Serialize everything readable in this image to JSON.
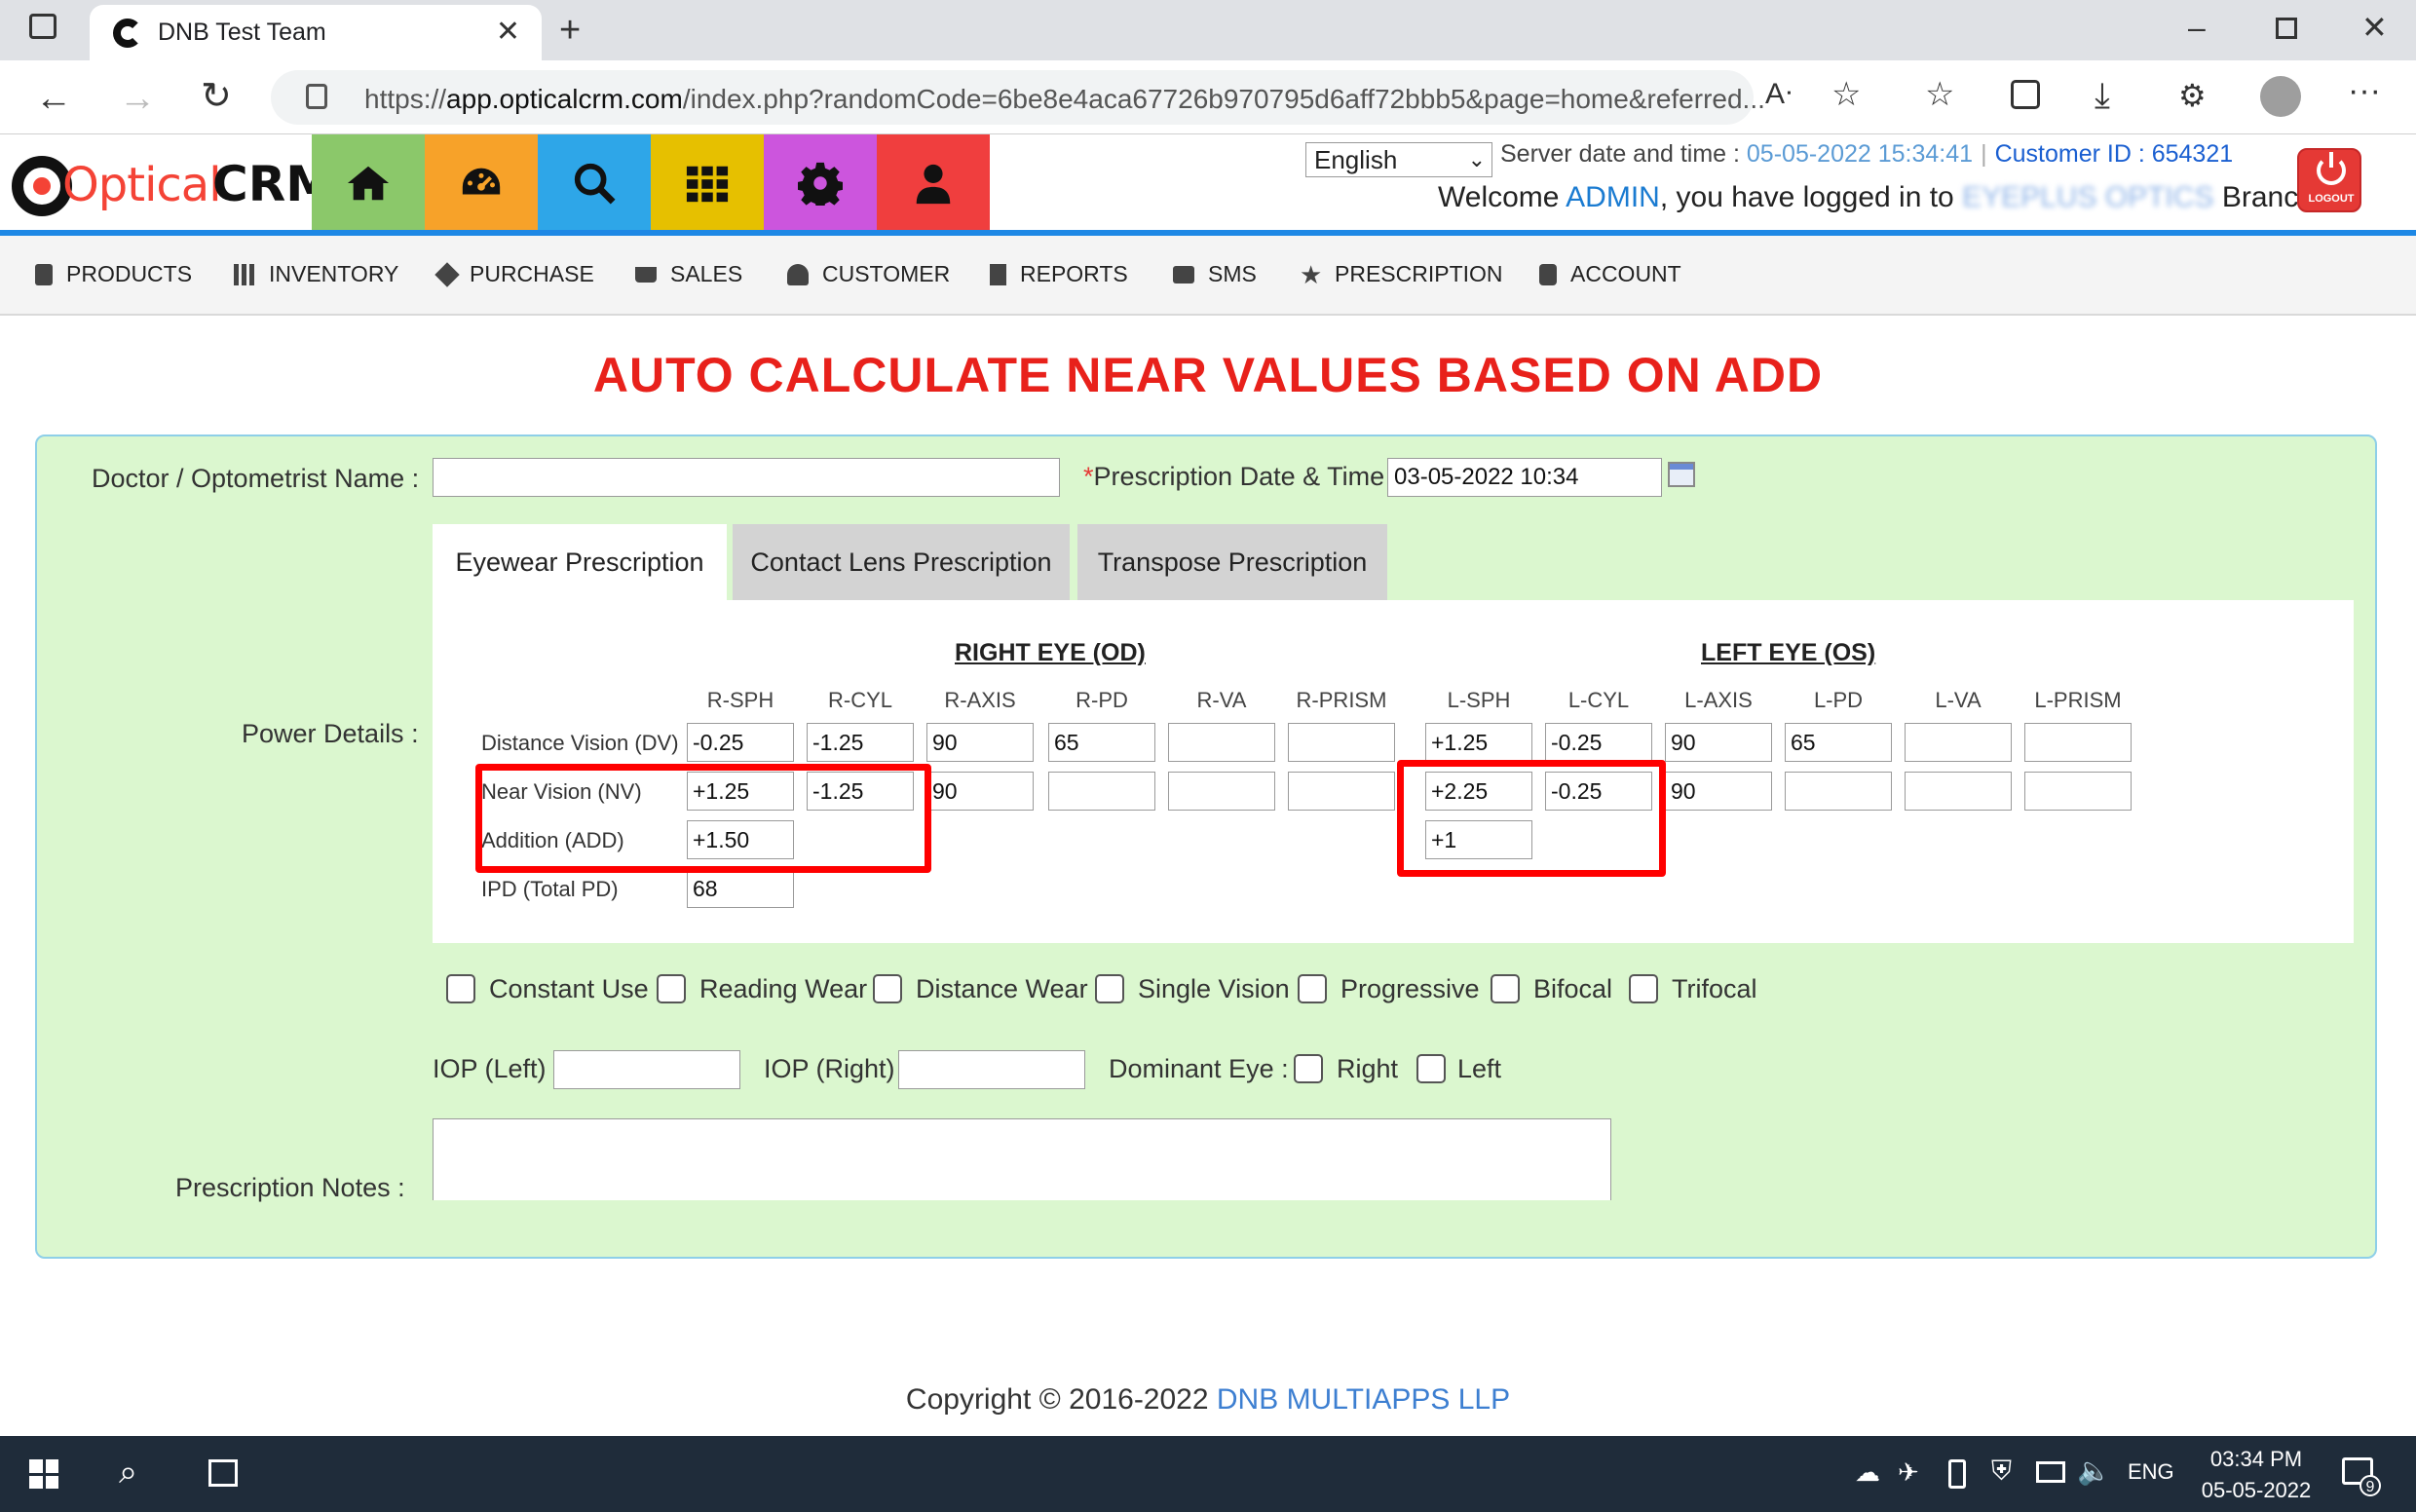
{
  "browser": {
    "tab_title": "DNB Test Team",
    "url_prefix": "https://",
    "url_host": "app.opticalcrm.com",
    "url_rest": "/index.php?randomCode=6be8e4aca67726b970795d6aff72bbb5&page=home&referred..."
  },
  "header": {
    "logo_part1": "Optical",
    "logo_part2": "CRM",
    "language": "English",
    "server_label": "Server date and time : ",
    "server_value": "05-05-2022 15:34:41",
    "customer_id_label": "Customer ID : 654321",
    "welcome_prefix": "Welcome ",
    "welcome_user": "ADMIN",
    "welcome_mid": ", you have logged in to ",
    "welcome_branch_blurred": "EYEPLUS OPTICS",
    "welcome_suffix": " Branch",
    "logout_label": "LOGOUT",
    "tile_colors": [
      "#8bc86a",
      "#f7a229",
      "#2ea6e8",
      "#e6c000",
      "#cc55dd",
      "#f03e3e"
    ]
  },
  "nav": [
    "PRODUCTS",
    "INVENTORY",
    "PURCHASE",
    "SALES",
    "CUSTOMER",
    "REPORTS",
    "SMS",
    "PRESCRIPTION",
    "ACCOUNT"
  ],
  "page": {
    "title": "AUTO CALCULATE NEAR VALUES BASED ON ADD",
    "doctor_label": "Doctor / Optometrist Name :",
    "doctor_value": "",
    "date_label_req": "*",
    "date_label": "Prescription Date & Time :",
    "date_value": "03-05-2022 10:34",
    "power_label": "Power Details :",
    "tabs": [
      "Eyewear Prescription",
      "Contact Lens Prescription",
      "Transpose Prescription"
    ],
    "right_eye": "RIGHT EYE (OD)",
    "left_eye": "LEFT EYE (OS)",
    "columns": [
      "R-SPH",
      "R-CYL",
      "R-AXIS",
      "R-PD",
      "R-VA",
      "R-PRISM",
      "L-SPH",
      "L-CYL",
      "L-AXIS",
      "L-PD",
      "L-VA",
      "L-PRISM"
    ],
    "rows": {
      "dv_label": "Distance Vision (DV)",
      "nv_label": "Near Vision (NV)",
      "add_label": "Addition (ADD)",
      "ipd_label": "IPD (Total PD)"
    },
    "dv": [
      "-0.25",
      "-1.25",
      "90",
      "65",
      "",
      "",
      "+1.25",
      "-0.25",
      "90",
      "65",
      "",
      ""
    ],
    "nv": [
      "+1.25",
      "-1.25",
      "90",
      "",
      "",
      "",
      "+2.25",
      "-0.25",
      "90",
      "",
      "",
      ""
    ],
    "add_right": "+1.50",
    "add_left": "+1",
    "ipd": "68",
    "lens_types": [
      "Constant Use",
      "Reading Wear",
      "Distance Wear",
      "Single Vision",
      "Progressive",
      "Bifocal",
      "Trifocal"
    ],
    "iop_left_label": "IOP (Left) :",
    "iop_right_label": "IOP (Right) :",
    "dominant_label": "Dominant Eye :",
    "dominant_right": "Right",
    "dominant_left": "Left",
    "notes_label": "Prescription Notes :"
  },
  "footer": {
    "copyright": "Copyright © 2016-2022 ",
    "company": "DNB MULTIAPPS LLP"
  },
  "taskbar": {
    "lang": "ENG",
    "time": "03:34 PM",
    "date": "05-05-2022",
    "notif_count": "9"
  }
}
